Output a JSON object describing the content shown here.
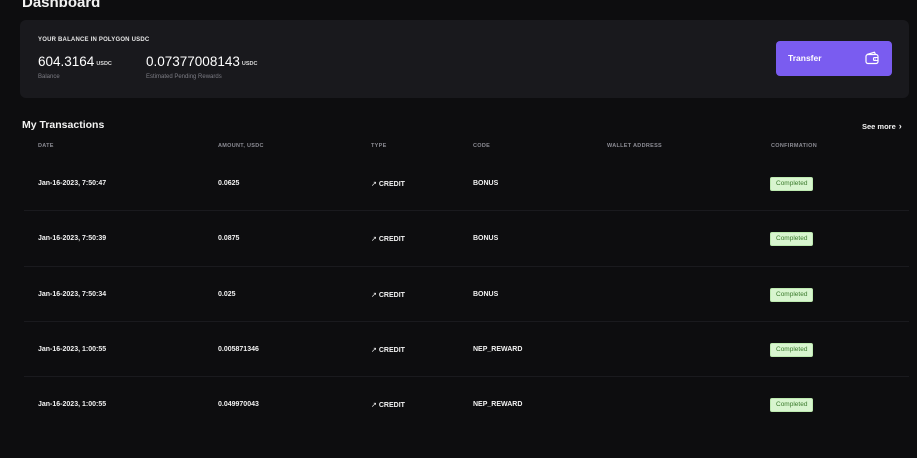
{
  "page": {
    "title": "Dashboard"
  },
  "balance": {
    "heading": "YOUR BALANCE IN POLYGON USDC",
    "balance_value": "604.3164",
    "balance_unit": "USDC",
    "balance_label": "Balance",
    "pending_value": "0.07377008143",
    "pending_unit": "USDC",
    "pending_label": "Estimated Pending Rewards",
    "transfer_label": "Transfer"
  },
  "transactions": {
    "title": "My Transactions",
    "see_more": "See more",
    "columns": {
      "date": "DATE",
      "amount": "AMOUNT, USDC",
      "type": "TYPE",
      "code": "CODE",
      "wallet": "WALLET ADDRESS",
      "confirmation": "CONFIRMATION"
    },
    "rows": [
      {
        "date": "Jan-16-2023, 7:50:47",
        "amount": "0.0625",
        "type_arrow": "↗",
        "type": "CREDIT",
        "code": "BONUS",
        "wallet": "",
        "status": "Completed"
      },
      {
        "date": "Jan-16-2023, 7:50:39",
        "amount": "0.0875",
        "type_arrow": "↗",
        "type": "CREDIT",
        "code": "BONUS",
        "wallet": "",
        "status": "Completed"
      },
      {
        "date": "Jan-16-2023, 7:50:34",
        "amount": "0.025",
        "type_arrow": "↗",
        "type": "CREDIT",
        "code": "BONUS",
        "wallet": "",
        "status": "Completed"
      },
      {
        "date": "Jan-16-2023, 1:00:55",
        "amount": "0.005871346",
        "type_arrow": "↗",
        "type": "CREDIT",
        "code": "NEP_REWARD",
        "wallet": "",
        "status": "Completed"
      },
      {
        "date": "Jan-16-2023, 1:00:55",
        "amount": "0.049970043",
        "type_arrow": "↗",
        "type": "CREDIT",
        "code": "NEP_REWARD",
        "wallet": "",
        "status": "Completed"
      }
    ]
  },
  "icons": {
    "transfer": "wallet-icon",
    "see_more": "chevron-right-icon",
    "type": "arrow-up-right-icon"
  },
  "colors": {
    "accent": "#7a5cf0",
    "status_bg": "#d8f5cf",
    "status_text": "#3a7a2c"
  }
}
